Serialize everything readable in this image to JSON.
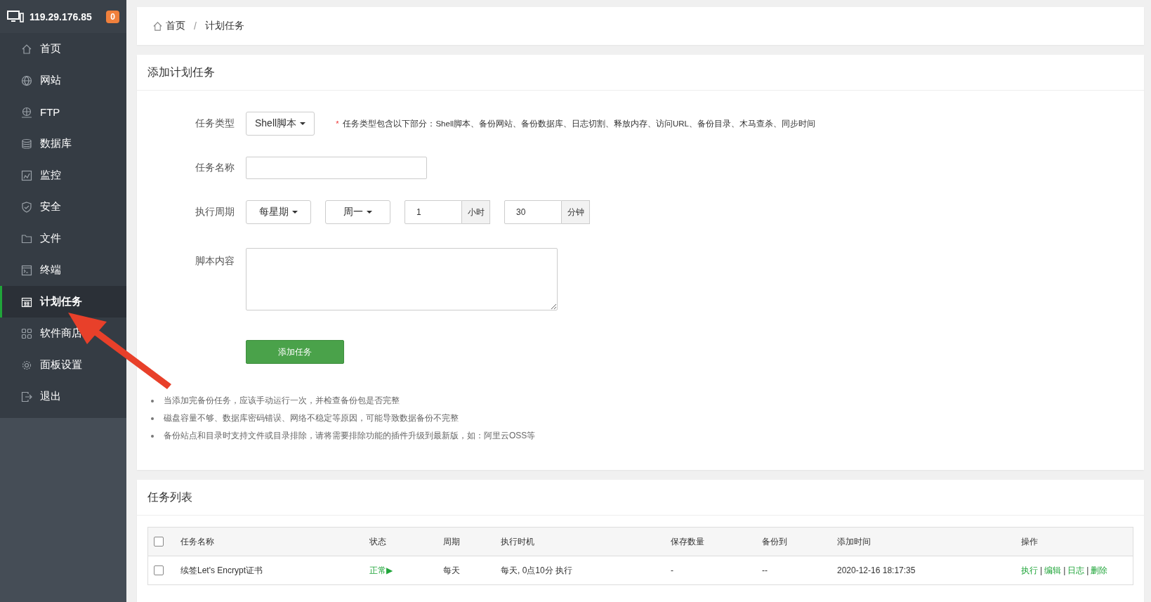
{
  "sidebar": {
    "server_ip": "119.29.176.85",
    "badge": "0",
    "items": [
      {
        "label": "首页",
        "selected": false
      },
      {
        "label": "网站",
        "selected": false
      },
      {
        "label": "FTP",
        "selected": false
      },
      {
        "label": "数据库",
        "selected": false
      },
      {
        "label": "监控",
        "selected": false
      },
      {
        "label": "安全",
        "selected": false
      },
      {
        "label": "文件",
        "selected": false
      },
      {
        "label": "终端",
        "selected": false
      },
      {
        "label": "计划任务",
        "selected": true
      },
      {
        "label": "软件商店",
        "selected": false
      },
      {
        "label": "面板设置",
        "selected": false
      },
      {
        "label": "退出",
        "selected": false
      }
    ]
  },
  "breadcrumb": {
    "items": [
      "首页",
      "计划任务"
    ],
    "separator": "/"
  },
  "form": {
    "title": "添加计划任务",
    "rows": [
      {
        "kind": "select",
        "label": "任务类型",
        "value": "Shell脚本",
        "required_mark": "*",
        "note": "任务类型包含以下部分：Shell脚本、备份网站、备份数据库、日志切割、释放内存、访问URL、备份目录、木马查杀、同步时间"
      },
      {
        "kind": "input",
        "label": "任务名称"
      },
      {
        "kind": "period",
        "label": "执行周期",
        "selects": [
          "每星期",
          "周一"
        ],
        "inputs": [
          {
            "value": "1",
            "unit": "小时"
          },
          {
            "value": "30",
            "unit": "分钟"
          }
        ]
      },
      {
        "kind": "textarea",
        "label": "脚本内容"
      }
    ],
    "submit": "添加任务",
    "notes": [
      "当添加完备份任务，应该手动运行一次，并检查备份包是否完整",
      "磁盘容量不够、数据库密码错误、网络不稳定等原因，可能导致数据备份不完整",
      "备份站点和目录时支持文件或目录排除，请将需要排除功能的插件升级到最新版，如：阿里云OSS等"
    ]
  },
  "task_list": {
    "title": "任务列表",
    "header_checked": false,
    "columns": [
      "任务名称",
      "状态",
      "周期",
      "执行时机",
      "保存数量",
      "备份到",
      "添加时间",
      "操作"
    ],
    "rows": [
      {
        "checked": false,
        "name": "续签Let's Encrypt证书",
        "status": "正常▶",
        "period": "每天",
        "timing": "每天, 0点10分 执行",
        "keep": "-",
        "backup_to": "--",
        "added": "2020-12-16 18:17:35",
        "actions": [
          "执行",
          "编辑",
          "日志",
          "删除"
        ]
      }
    ],
    "action_separator": "|"
  }
}
